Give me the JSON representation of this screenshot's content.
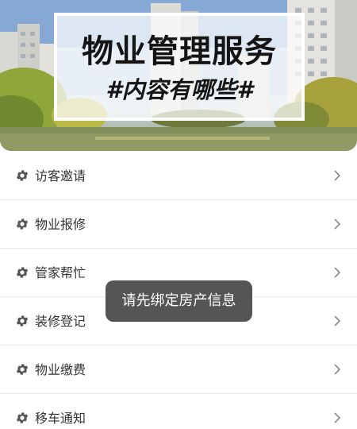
{
  "banner": {
    "title": "物业管理服务",
    "subtitle": "#内容有哪些#"
  },
  "menu": {
    "icon": "gear-icon",
    "items": [
      {
        "label": "访客邀请"
      },
      {
        "label": "物业报修"
      },
      {
        "label": "管家帮忙"
      },
      {
        "label": "装修登记"
      },
      {
        "label": "物业缴费"
      },
      {
        "label": "移车通知"
      }
    ]
  },
  "toast": {
    "text": "请先绑定房产信息"
  },
  "colors": {
    "text": "#333333",
    "icon": "#555555",
    "chevron": "#888888",
    "divider": "#ececec",
    "toast_bg": "#4c4c4c"
  }
}
